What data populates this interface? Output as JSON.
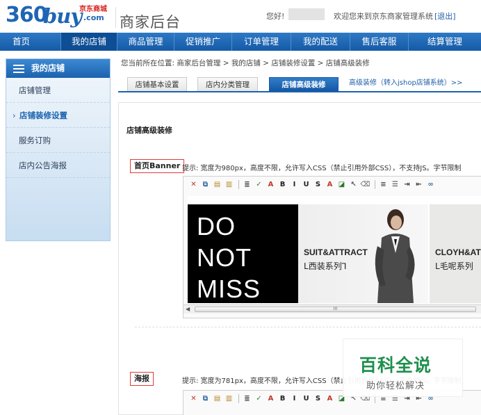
{
  "header": {
    "logo": {
      "main": "360buy",
      "n360": "360",
      "buy": "buy",
      "jd": "京东商城",
      "com": ".com"
    },
    "title": "商家后台",
    "greeting": "您好!",
    "welcome": "欢迎您来到京东商家管理系统",
    "logout": "[退出]"
  },
  "nav": {
    "items": [
      {
        "label": "首页"
      },
      {
        "label": "我的店铺",
        "active": true
      },
      {
        "label": "商品管理"
      },
      {
        "label": "促销推广"
      },
      {
        "label": "订单管理"
      },
      {
        "label": "我的配送"
      },
      {
        "label": "售后客服"
      },
      {
        "label": "结算管理"
      }
    ]
  },
  "sidebar": {
    "title": "我的店铺",
    "items": [
      {
        "label": "店铺管理"
      },
      {
        "label": "店铺装修设置",
        "active": true
      },
      {
        "label": "服务订购"
      },
      {
        "label": "店内公告海报"
      }
    ]
  },
  "breadcrumb": "您当前所在位置: 商家后台管理 > 我的店铺 > 店铺装修设置 > 店铺高级装修",
  "tabs": [
    {
      "label": "店铺基本设置"
    },
    {
      "label": "店内分类管理"
    },
    {
      "label": "店铺高级装修",
      "active": true
    }
  ],
  "tab_link": "高级装修（转入jshop店铺系统）>>",
  "main": {
    "section_title": "店铺高级装修",
    "banner": {
      "label": "首页Banner",
      "hint": "提示: 宽度为980px，高度不限，允许写入CSS（禁止引用外部CSS），不支持JS。字节限制",
      "big_text": [
        "DO",
        "NOT",
        "MISS"
      ],
      "suit_en": "SUIT&ATTRACT",
      "suit_cn": "西装系列",
      "cloy_en": "CLOYH&AT",
      "cloy_cn": "毛呢系列",
      "scroll_marker": "III"
    },
    "poster": {
      "label": "海报",
      "hint": "提示: 宽度为781px，高度不限，允许写入CSS（禁止引用外部CSS），不支持JS。字节限制"
    },
    "toolbar_icons": [
      {
        "name": "cut-icon",
        "glyph": "✕",
        "color": "#c0392b"
      },
      {
        "name": "copy-icon",
        "glyph": "⧉",
        "color": "#3a6ea5"
      },
      {
        "name": "paste-icon",
        "glyph": "▤",
        "color": "#b58a2a"
      },
      {
        "name": "paste-word-icon",
        "glyph": "▥",
        "color": "#b58a2a"
      },
      {
        "name": "sep"
      },
      {
        "name": "format-icon",
        "glyph": "≣",
        "color": "#444"
      },
      {
        "name": "spellcheck-icon",
        "glyph": "✓",
        "color": "#3a7a3a"
      },
      {
        "name": "font-icon",
        "glyph": "A",
        "color": "#c0392b"
      },
      {
        "name": "bold-icon",
        "glyph": "B",
        "color": "#222"
      },
      {
        "name": "italic-icon",
        "glyph": "I",
        "color": "#222"
      },
      {
        "name": "underline-icon",
        "glyph": "U",
        "color": "#222"
      },
      {
        "name": "strike-icon",
        "glyph": "S",
        "color": "#222"
      },
      {
        "name": "font-color-icon",
        "glyph": "A",
        "color": "#c0392b"
      },
      {
        "name": "bg-color-icon",
        "glyph": "◪",
        "color": "#2a7a2a"
      },
      {
        "name": "pointer-icon",
        "glyph": "↖",
        "color": "#555"
      },
      {
        "name": "eraser-icon",
        "glyph": "⌫",
        "color": "#777"
      },
      {
        "name": "sep"
      },
      {
        "name": "align-left-icon",
        "glyph": "≡",
        "color": "#444"
      },
      {
        "name": "list-icon",
        "glyph": "☰",
        "color": "#444"
      },
      {
        "name": "indent-icon",
        "glyph": "⇥",
        "color": "#444"
      },
      {
        "name": "outdent-icon",
        "glyph": "⇤",
        "color": "#444"
      },
      {
        "name": "link-icon",
        "glyph": "∞",
        "color": "#3a6ea5"
      }
    ]
  },
  "watermark": {
    "main": "百科全说",
    "sub": "助你轻松解决"
  },
  "colors": {
    "nav": "#1b62ae",
    "label_border": "#e23a3a",
    "watermark": "#1f8f4e"
  }
}
